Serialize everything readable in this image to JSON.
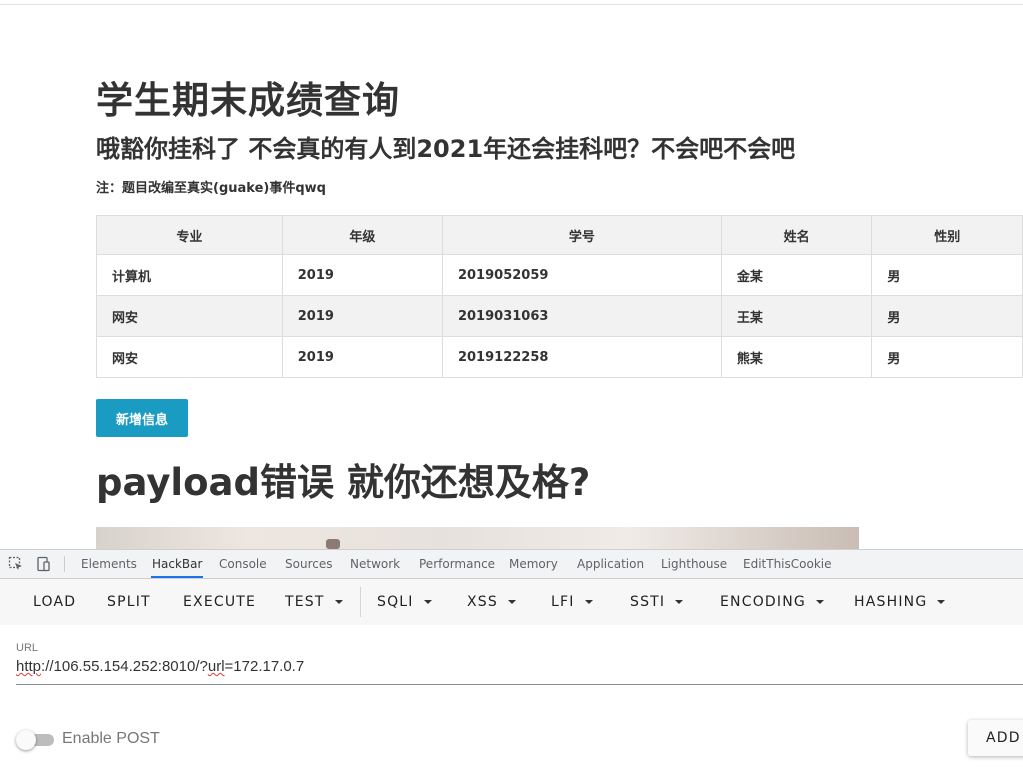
{
  "page": {
    "title": "学生期末成绩查询",
    "subtitle": "哦豁你挂科了 不会真的有人到2021年还会挂科吧？不会吧不会吧",
    "note": "注：题目改编至真实(guake)事件qwq",
    "add_button": "新增信息",
    "payload_heading": "payload错误 就你还想及格?"
  },
  "table": {
    "headers": [
      "专业",
      "年级",
      "学号",
      "姓名",
      "性别"
    ],
    "rows": [
      [
        "计算机",
        "2019",
        "2019052059",
        "金某",
        "男"
      ],
      [
        "网安",
        "2019",
        "2019031063",
        "王某",
        "男"
      ],
      [
        "网安",
        "2019",
        "2019122258",
        "熊某",
        "男"
      ]
    ]
  },
  "devtools": {
    "tabs": [
      "Elements",
      "HackBar",
      "Console",
      "Sources",
      "Network",
      "Performance",
      "Memory",
      "Application",
      "Lighthouse",
      "EditThisCookie"
    ],
    "active_tab": "HackBar",
    "icons": [
      "inspect-element-icon",
      "device-toggle-icon"
    ]
  },
  "hackbar": {
    "buttons": [
      "LOAD",
      "SPLIT",
      "EXECUTE",
      "TEST",
      "SQLI",
      "XSS",
      "LFI",
      "SSTI",
      "ENCODING",
      "HASHING"
    ],
    "url_label": "URL",
    "url_parts": [
      "http",
      "://106.55.154.252:8010/?",
      "url",
      "=172.17.0.7"
    ],
    "enable_post_label": "Enable POST",
    "enable_post": false,
    "add_header_button": "ADD"
  },
  "colors": {
    "primary_button": "#1a9bc2",
    "active_tab_underline": "#1a73e8"
  }
}
